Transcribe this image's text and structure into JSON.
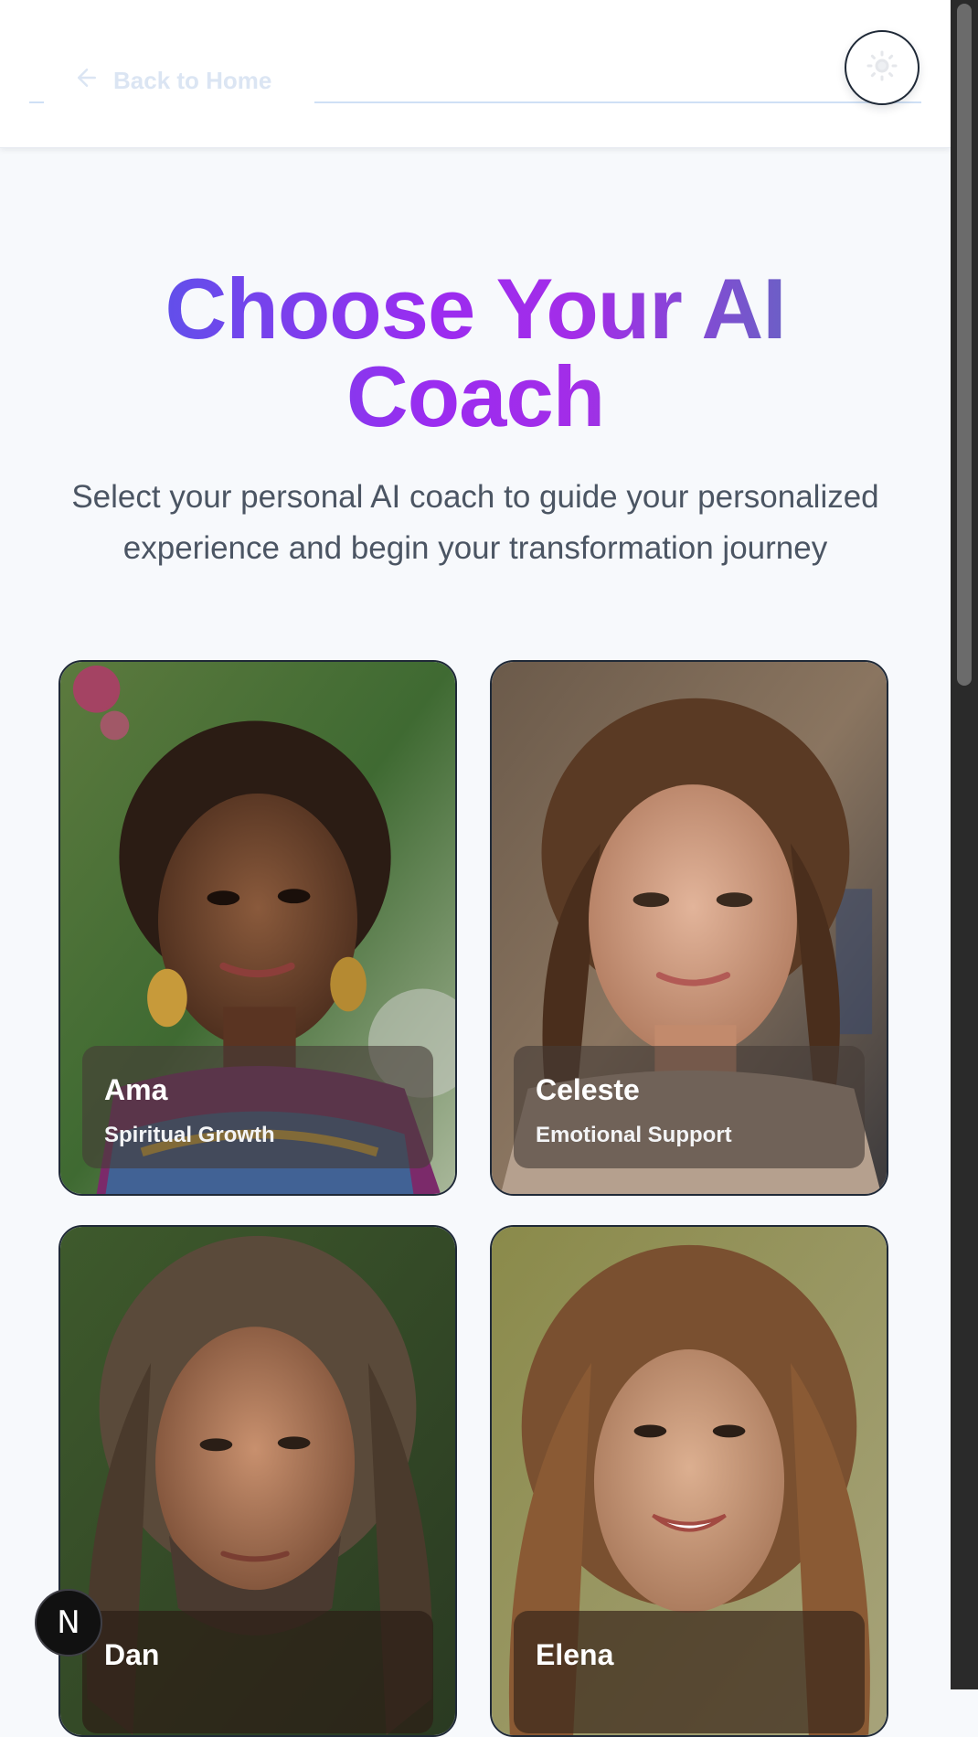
{
  "header": {
    "back_label": "Back to Home",
    "back_icon": "arrow-left-icon",
    "theme_icon": "sun-icon"
  },
  "hero": {
    "title": "Choose Your AI Coach",
    "subtitle": "Select your personal AI coach to guide your personalized experience and begin your transformation journey"
  },
  "coaches": [
    {
      "name": "Ama",
      "specialty": "Spiritual Growth"
    },
    {
      "name": "Celeste",
      "specialty": "Emotional Support"
    },
    {
      "name": "Dan",
      "specialty": ""
    },
    {
      "name": "Elena",
      "specialty": ""
    }
  ],
  "devtools": {
    "badge_label": "N"
  },
  "colors": {
    "title_gradient": [
      "#4a5ee8",
      "#9b2cf0",
      "#4f7ab4"
    ],
    "card_border": "#1f2937",
    "background": "#f7f9fc"
  }
}
